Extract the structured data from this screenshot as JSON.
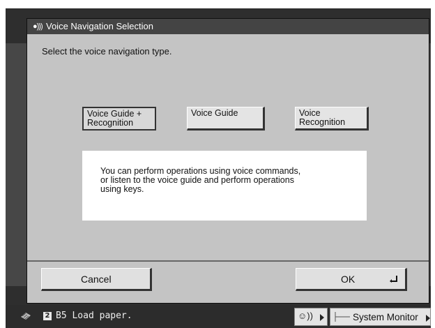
{
  "dialog": {
    "title": "Voice Navigation Selection",
    "title_icon": "voice-wave-icon",
    "prompt": "Select the voice navigation type.",
    "options": [
      {
        "line1": "Voice Guide +",
        "line2": "Recognition",
        "selected": true
      },
      {
        "line1": "Voice Guide",
        "line2": "",
        "selected": false
      },
      {
        "line1": "Voice",
        "line2": "Recognition",
        "selected": false
      }
    ],
    "info_lines": [
      "You can perform operations using voice commands,",
      "or  listen to the voice guide and perform operations",
      "using keys."
    ],
    "cancel_label": "Cancel",
    "ok_label": "OK"
  },
  "status_bar": {
    "job_number": "2",
    "message": "B5 Load paper.",
    "system_monitor_label": "System Monitor"
  },
  "colors": {
    "panel": "#c4c4c4",
    "title_bar": "#444444",
    "button_face": "#e0e0e0"
  }
}
